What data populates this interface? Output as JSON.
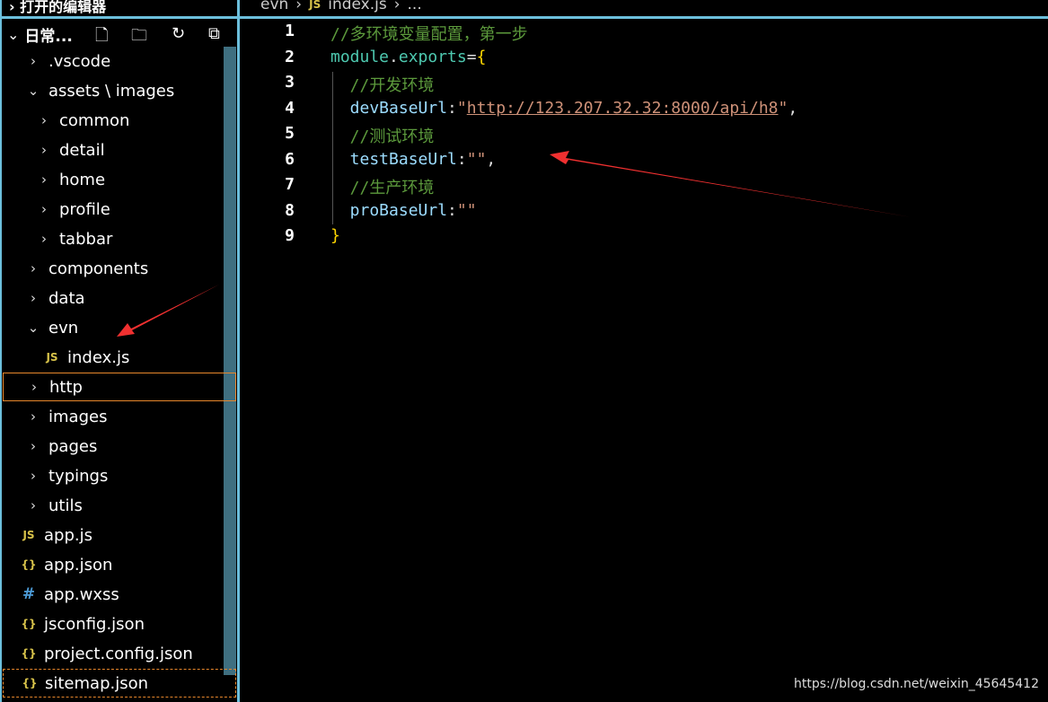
{
  "open_editors_label": "打开的编辑器",
  "breadcrumb": [
    "evn",
    "index.js",
    "..."
  ],
  "workspace": {
    "title": "日常...",
    "actions": [
      "new-file-icon",
      "new-folder-icon",
      "refresh-icon",
      "collapse-all-icon"
    ]
  },
  "tree": [
    {
      "label": ".vscode",
      "type": "folder",
      "expanded": false,
      "depth": 0
    },
    {
      "label": "assets \\ images",
      "type": "folder",
      "expanded": true,
      "depth": 0
    },
    {
      "label": "common",
      "type": "folder",
      "expanded": false,
      "depth": 1
    },
    {
      "label": "detail",
      "type": "folder",
      "expanded": false,
      "depth": 1
    },
    {
      "label": "home",
      "type": "folder",
      "expanded": false,
      "depth": 1
    },
    {
      "label": "profile",
      "type": "folder",
      "expanded": false,
      "depth": 1
    },
    {
      "label": "tabbar",
      "type": "folder",
      "expanded": false,
      "depth": 1
    },
    {
      "label": "components",
      "type": "folder",
      "expanded": false,
      "depth": 0
    },
    {
      "label": "data",
      "type": "folder",
      "expanded": false,
      "depth": 0
    },
    {
      "label": "evn",
      "type": "folder",
      "expanded": true,
      "depth": 0
    },
    {
      "label": "index.js",
      "type": "js",
      "depth": 1
    },
    {
      "label": "http",
      "type": "folder",
      "expanded": false,
      "depth": 0,
      "focused": true
    },
    {
      "label": "images",
      "type": "folder",
      "expanded": false,
      "depth": 0
    },
    {
      "label": "pages",
      "type": "folder",
      "expanded": false,
      "depth": 0
    },
    {
      "label": "typings",
      "type": "folder",
      "expanded": false,
      "depth": 0
    },
    {
      "label": "utils",
      "type": "folder",
      "expanded": false,
      "depth": 0
    },
    {
      "label": "app.js",
      "type": "js",
      "depth": 0
    },
    {
      "label": "app.json",
      "type": "json",
      "depth": 0
    },
    {
      "label": "app.wxss",
      "type": "css",
      "depth": 0
    },
    {
      "label": "jsconfig.json",
      "type": "json",
      "depth": 0
    },
    {
      "label": "project.config.json",
      "type": "json",
      "depth": 0
    },
    {
      "label": "sitemap.json",
      "type": "json",
      "depth": 0,
      "dashed": true
    }
  ],
  "icons": {
    "js": "JS",
    "json": "{}",
    "css": "#"
  },
  "code_lines": [
    [
      {
        "c": "cm",
        "t": "//多环境变量配置，第一步"
      }
    ],
    [
      {
        "c": "id",
        "t": "module"
      },
      {
        "c": "pn",
        "t": "."
      },
      {
        "c": "id",
        "t": "exports"
      },
      {
        "c": "pn",
        "t": "="
      },
      {
        "c": "br",
        "t": "{"
      }
    ],
    [
      {
        "c": "cm",
        "t": "  //开发环境"
      }
    ],
    [
      {
        "c": "pr",
        "t": "  devBaseUrl"
      },
      {
        "c": "pn",
        "t": ":"
      },
      {
        "c": "st",
        "t": "\""
      },
      {
        "c": "st url",
        "t": "http://123.207.32.32:8000/api/h8"
      },
      {
        "c": "st",
        "t": "\""
      },
      {
        "c": "pn",
        "t": ","
      }
    ],
    [
      {
        "c": "cm",
        "t": "  //测试环境"
      }
    ],
    [
      {
        "c": "pr",
        "t": "  testBaseUrl"
      },
      {
        "c": "pn",
        "t": ":"
      },
      {
        "c": "st",
        "t": "\"\""
      },
      {
        "c": "pn",
        "t": ","
      }
    ],
    [
      {
        "c": "cm",
        "t": "  //生产环境"
      }
    ],
    [
      {
        "c": "pr",
        "t": "  proBaseUrl"
      },
      {
        "c": "pn",
        "t": ":"
      },
      {
        "c": "st",
        "t": "\"\""
      }
    ],
    [
      {
        "c": "br",
        "t": "}"
      }
    ]
  ],
  "watermark": "https://blog.csdn.net/weixin_45645412",
  "colors": {
    "accent_border": "#6cbfdc",
    "focus_border": "#e8872b",
    "annotation_arrow": "#f03030"
  }
}
